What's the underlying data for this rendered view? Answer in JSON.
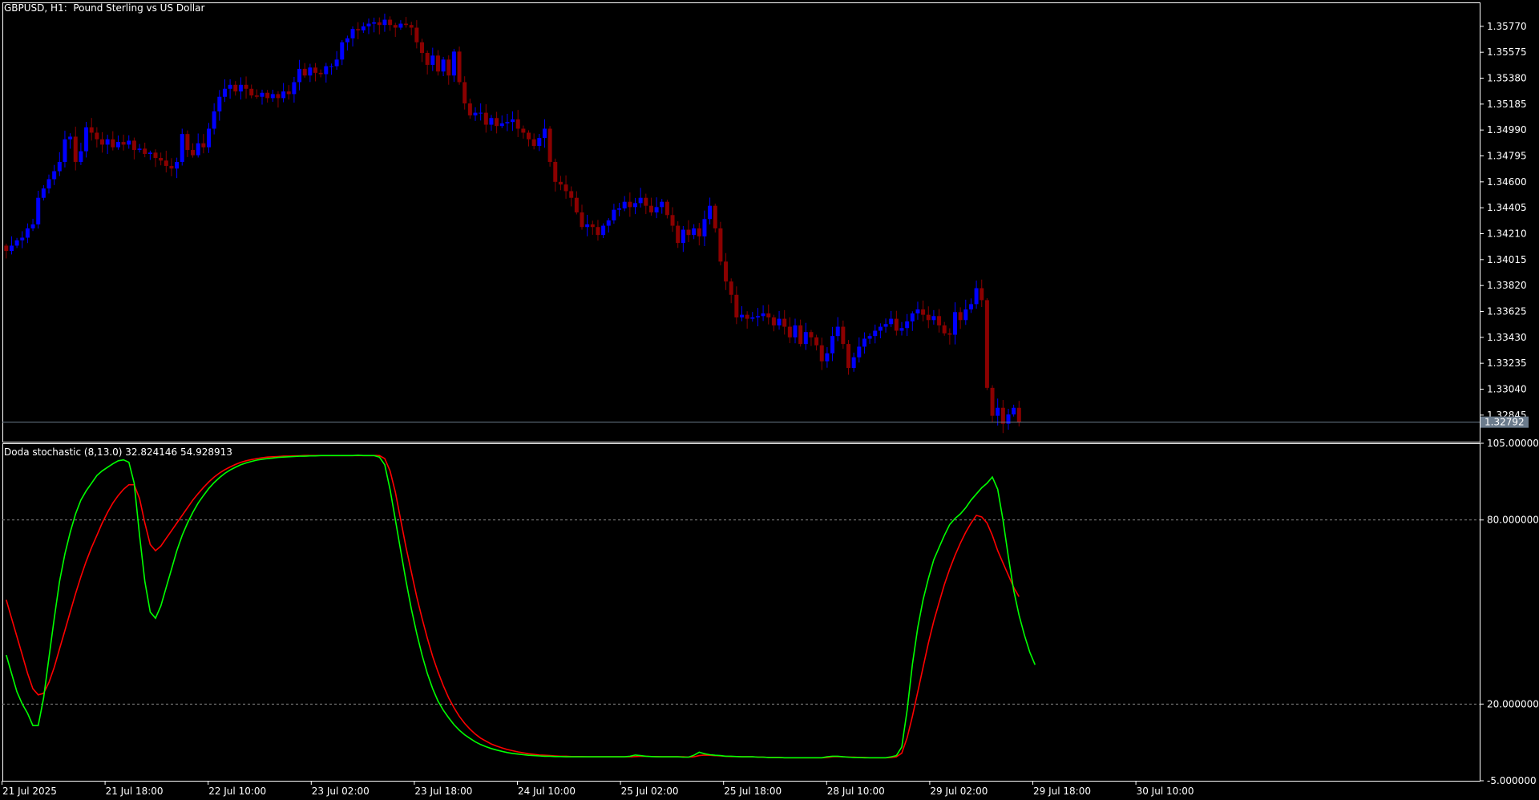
{
  "window": {
    "symbol_title": "GBPUSD, H1:  Pound Sterling vs US Dollar",
    "indicator_title": "Doda stochastic (8,13.0) 32.824146 54.928913",
    "current_price_label": "1.32792"
  },
  "colors": {
    "background": "#000000",
    "bull_candle": "#0000ff",
    "bear_candle": "#8b0000",
    "wick": "#888888",
    "axis": "#ffffff",
    "stoch_main": "#00ff00",
    "stoch_signal": "#ff0000",
    "level_line": "#888888",
    "price_line": "#6b7b8c"
  },
  "chart_data": [
    {
      "type": "candlestick",
      "title": "GBPUSD, H1:  Pound Sterling vs US Dollar",
      "ylim": [
        1.32645,
        1.3595
      ],
      "y_ticks": [
        "1.35770",
        "1.35575",
        "1.35380",
        "1.35185",
        "1.34990",
        "1.34795",
        "1.34600",
        "1.34405",
        "1.34210",
        "1.34015",
        "1.33820",
        "1.33625",
        "1.33430",
        "1.33235",
        "1.33040",
        "1.32845"
      ],
      "current_price": 1.32792,
      "closes": [
        1.3408,
        1.3412,
        1.3416,
        1.3418,
        1.3425,
        1.3428,
        1.3448,
        1.3455,
        1.3462,
        1.3468,
        1.3475,
        1.3492,
        1.3494,
        1.3475,
        1.3483,
        1.3501,
        1.3497,
        1.3492,
        1.3488,
        1.3492,
        1.3486,
        1.349,
        1.3488,
        1.3491,
        1.3484,
        1.3485,
        1.3481,
        1.3482,
        1.3478,
        1.3476,
        1.3472,
        1.347,
        1.3475,
        1.3496,
        1.3484,
        1.348,
        1.3489,
        1.3486,
        1.35,
        1.3513,
        1.3524,
        1.353,
        1.3533,
        1.3528,
        1.3533,
        1.353,
        1.3525,
        1.3524,
        1.3527,
        1.3523,
        1.3526,
        1.3523,
        1.3528,
        1.3526,
        1.3535,
        1.3545,
        1.354,
        1.3546,
        1.3542,
        1.3541,
        1.3547,
        1.3547,
        1.3552,
        1.3565,
        1.3568,
        1.3575,
        1.3574,
        1.3577,
        1.3579,
        1.358,
        1.3578,
        1.3582,
        1.3578,
        1.3576,
        1.3579,
        1.3578,
        1.3576,
        1.3565,
        1.3557,
        1.3548,
        1.3555,
        1.3543,
        1.3552,
        1.354,
        1.3558,
        1.3535,
        1.3519,
        1.351,
        1.3512,
        1.3512,
        1.3503,
        1.3508,
        1.3502,
        1.3504,
        1.3505,
        1.3507,
        1.35,
        1.3497,
        1.3492,
        1.3487,
        1.3493,
        1.35,
        1.3475,
        1.346,
        1.3458,
        1.3453,
        1.3448,
        1.3437,
        1.3426,
        1.3428,
        1.3426,
        1.342,
        1.3427,
        1.3431,
        1.3439,
        1.344,
        1.3445,
        1.3441,
        1.3444,
        1.3448,
        1.3442,
        1.3437,
        1.3441,
        1.3445,
        1.3435,
        1.3427,
        1.3414,
        1.3424,
        1.342,
        1.3425,
        1.3419,
        1.3432,
        1.3442,
        1.3425,
        1.34,
        1.3385,
        1.3375,
        1.3358,
        1.336,
        1.3357,
        1.3358,
        1.3359,
        1.3361,
        1.3358,
        1.3352,
        1.3357,
        1.3351,
        1.3343,
        1.3352,
        1.3338,
        1.3347,
        1.3343,
        1.3337,
        1.3325,
        1.3331,
        1.3344,
        1.3351,
        1.3338,
        1.332,
        1.3328,
        1.3336,
        1.3342,
        1.3344,
        1.3348,
        1.3351,
        1.3353,
        1.3357,
        1.3348,
        1.335,
        1.3355,
        1.3361,
        1.3364,
        1.336,
        1.3356,
        1.3359,
        1.3352,
        1.3346,
        1.3345,
        1.3362,
        1.3356,
        1.3364,
        1.3368,
        1.338,
        1.3371,
        1.3305,
        1.3284,
        1.329,
        1.3278,
        1.3285,
        1.329,
        1.3279
      ]
    },
    {
      "type": "line",
      "title": "Doda stochastic (8,13.0) 32.824146 54.928913",
      "ylim": [
        -5,
        105
      ],
      "y_ticks": [
        "105.000000",
        "80.000000",
        "20.000000",
        "-5.000000"
      ],
      "levels": [
        80,
        20
      ],
      "x_tick_labels": [
        "21 Jul 2025",
        "21 Jul 18:00",
        "22 Jul 10:00",
        "23 Jul 02:00",
        "23 Jul 18:00",
        "24 Jul 10:00",
        "25 Jul 02:00",
        "25 Jul 18:00",
        "28 Jul 10:00",
        "29 Jul 02:00",
        "29 Jul 18:00",
        "30 Jul 10:00"
      ],
      "series": [
        {
          "values": [
            36.0,
            30.0,
            24.0,
            20.0,
            17.0,
            13.0,
            13.0,
            22.0,
            35.0,
            48.0,
            60.0,
            69.0,
            76.0,
            82.0,
            86.5,
            89.5,
            92.0,
            94.5,
            96.0,
            97.2,
            98.3,
            99.3,
            99.6,
            98.8,
            92.0,
            75.0,
            60.0,
            50.0,
            48.0,
            52.0,
            58.0,
            64.0,
            70.0,
            75.0,
            79.0,
            82.5,
            85.5,
            88.0,
            90.3,
            92.2,
            93.8,
            95.2,
            96.3,
            97.2,
            98.0,
            98.6,
            99.1,
            99.5,
            99.8,
            100.0,
            100.2,
            100.4,
            100.5,
            100.6,
            100.7,
            100.8,
            100.8,
            100.9,
            100.9,
            101.0,
            101.0,
            101.0,
            101.0,
            101.0,
            101.0,
            101.0,
            101.1,
            101.0,
            101.0,
            101.0,
            100.5,
            98.0,
            90.0,
            80.0,
            70.0,
            60.0,
            51.0,
            43.0,
            36.0,
            30.0,
            25.0,
            21.0,
            18.0,
            15.5,
            13.3,
            11.5,
            10.0,
            8.8,
            7.7,
            6.8,
            6.1,
            5.5,
            5.0,
            4.6,
            4.2,
            3.9,
            3.7,
            3.5,
            3.3,
            3.2,
            3.1,
            3.0,
            3.0,
            2.9,
            2.9,
            2.8,
            2.8,
            2.8,
            2.8,
            2.8,
            2.8,
            2.8,
            2.8,
            2.8,
            2.8,
            2.8,
            2.8,
            3.0,
            3.4,
            3.2,
            3.0,
            2.9,
            2.8,
            2.8,
            2.8,
            2.8,
            2.8,
            2.7,
            2.7,
            3.3,
            4.3,
            3.8,
            3.5,
            3.3,
            3.2,
            3.0,
            3.0,
            2.9,
            2.8,
            2.8,
            2.8,
            2.7,
            2.7,
            2.6,
            2.6,
            2.6,
            2.5,
            2.5,
            2.5,
            2.5,
            2.5,
            2.5,
            2.5,
            2.5,
            2.8,
            3.0,
            3.0,
            2.8,
            2.7,
            2.6,
            2.6,
            2.5,
            2.5,
            2.5,
            2.5,
            2.5,
            2.8,
            3.2,
            6.0,
            18.0,
            33.0,
            45.0,
            54.0,
            61.0,
            67.0,
            71.0,
            75.0,
            78.5,
            80.5,
            82.0,
            84.0,
            86.5,
            88.5,
            90.5,
            92.0,
            94.0,
            90.0,
            80.0,
            68.0,
            57.0,
            49.0,
            42.5,
            37.0,
            32.8
          ]
        },
        {
          "values": [
            54.0,
            48.0,
            42.0,
            36.0,
            30.0,
            25.0,
            23.0,
            23.5,
            27.0,
            32.0,
            38.0,
            44.0,
            50.0,
            56.0,
            61.5,
            66.5,
            71.0,
            75.0,
            79.0,
            82.5,
            85.5,
            88.0,
            90.0,
            91.5,
            91.5,
            87.0,
            79.0,
            72.0,
            70.0,
            71.5,
            74.0,
            76.5,
            79.0,
            81.5,
            84.0,
            86.5,
            88.6,
            90.6,
            92.4,
            94.0,
            95.3,
            96.4,
            97.3,
            98.1,
            98.8,
            99.3,
            99.7,
            100.0,
            100.3,
            100.5,
            100.6,
            100.7,
            100.8,
            100.8,
            100.9,
            100.9,
            101.0,
            101.0,
            101.0,
            101.0,
            101.0,
            101.0,
            101.0,
            101.0,
            101.0,
            101.0,
            101.0,
            101.0,
            101.0,
            101.0,
            101.0,
            100.0,
            96.0,
            89.0,
            80.0,
            71.0,
            63.0,
            55.0,
            48.0,
            41.5,
            35.5,
            30.5,
            26.0,
            22.0,
            18.8,
            16.0,
            13.7,
            11.8,
            10.2,
            8.9,
            7.9,
            7.0,
            6.3,
            5.7,
            5.2,
            4.8,
            4.4,
            4.1,
            3.8,
            3.6,
            3.4,
            3.3,
            3.2,
            3.1,
            3.0,
            3.0,
            2.9,
            2.9,
            2.9,
            2.8,
            2.8,
            2.8,
            2.8,
            2.8,
            2.8,
            2.8,
            2.8,
            2.8,
            2.9,
            3.0,
            3.0,
            2.9,
            2.9,
            2.8,
            2.8,
            2.8,
            2.8,
            2.8,
            2.7,
            2.8,
            3.2,
            3.4,
            3.3,
            3.2,
            3.1,
            3.0,
            2.9,
            2.9,
            2.8,
            2.8,
            2.8,
            2.7,
            2.7,
            2.6,
            2.6,
            2.6,
            2.5,
            2.5,
            2.5,
            2.5,
            2.5,
            2.5,
            2.5,
            2.5,
            2.6,
            2.8,
            2.9,
            2.8,
            2.7,
            2.7,
            2.6,
            2.6,
            2.5,
            2.5,
            2.5,
            2.5,
            2.6,
            2.8,
            4.0,
            9.0,
            16.0,
            24.0,
            32.0,
            40.0,
            47.0,
            53.0,
            59.0,
            64.0,
            68.5,
            72.5,
            76.0,
            79.0,
            81.5,
            81.0,
            79.0,
            75.0,
            70.0,
            66.0,
            62.0,
            58.0,
            55.0
          ]
        }
      ]
    }
  ]
}
